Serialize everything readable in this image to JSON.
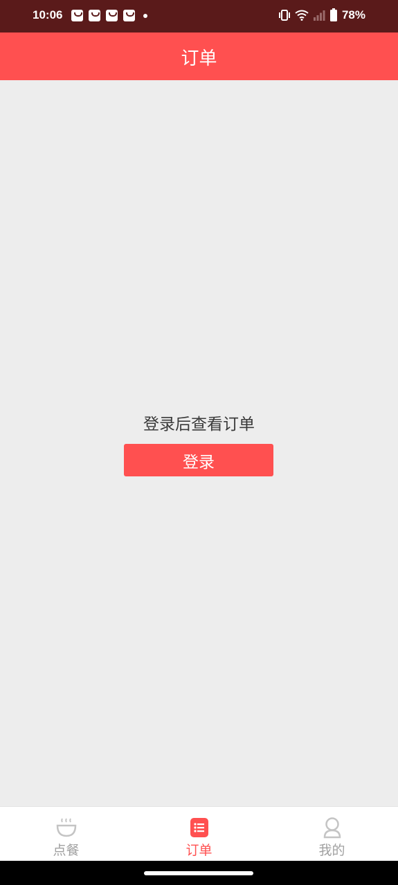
{
  "status_bar": {
    "time": "10:06",
    "battery": "78%",
    "notification_icons": [
      "shopping-bag-icon",
      "shopping-bag-icon",
      "shopping-bag-icon",
      "shopping-bag-icon"
    ]
  },
  "header": {
    "title": "订单"
  },
  "main": {
    "message": "登录后查看订单",
    "login_label": "登录"
  },
  "tabs": [
    {
      "label": "点餐",
      "icon": "bowl-icon",
      "active": false
    },
    {
      "label": "订单",
      "icon": "order-list-icon",
      "active": true
    },
    {
      "label": "我的",
      "icon": "person-icon",
      "active": false
    }
  ],
  "colors": {
    "accent": "#ff5050",
    "status_bar": "#5a1a1a",
    "background": "#ededed",
    "tab_inactive": "#a0a0a0"
  }
}
